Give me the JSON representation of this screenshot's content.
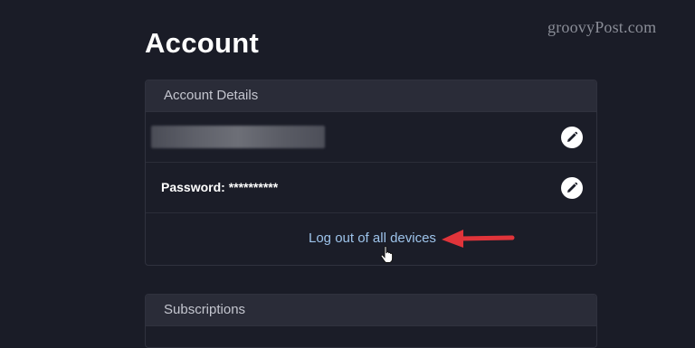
{
  "watermark": "groovyPost.com",
  "page": {
    "title": "Account"
  },
  "account_details": {
    "header": "Account Details",
    "email_value": "",
    "password_label": "Password: **********",
    "logout_link": "Log out of all devices"
  },
  "subscriptions": {
    "header": "Subscriptions"
  },
  "icons": {
    "edit": "pencil-icon",
    "cursor": "hand-pointer-icon",
    "annotation": "red-arrow-annotation"
  },
  "colors": {
    "background": "#1a1c27",
    "card_header": "#2a2c38",
    "link": "#9dc3ea",
    "annotation_arrow": "#e0343a"
  }
}
